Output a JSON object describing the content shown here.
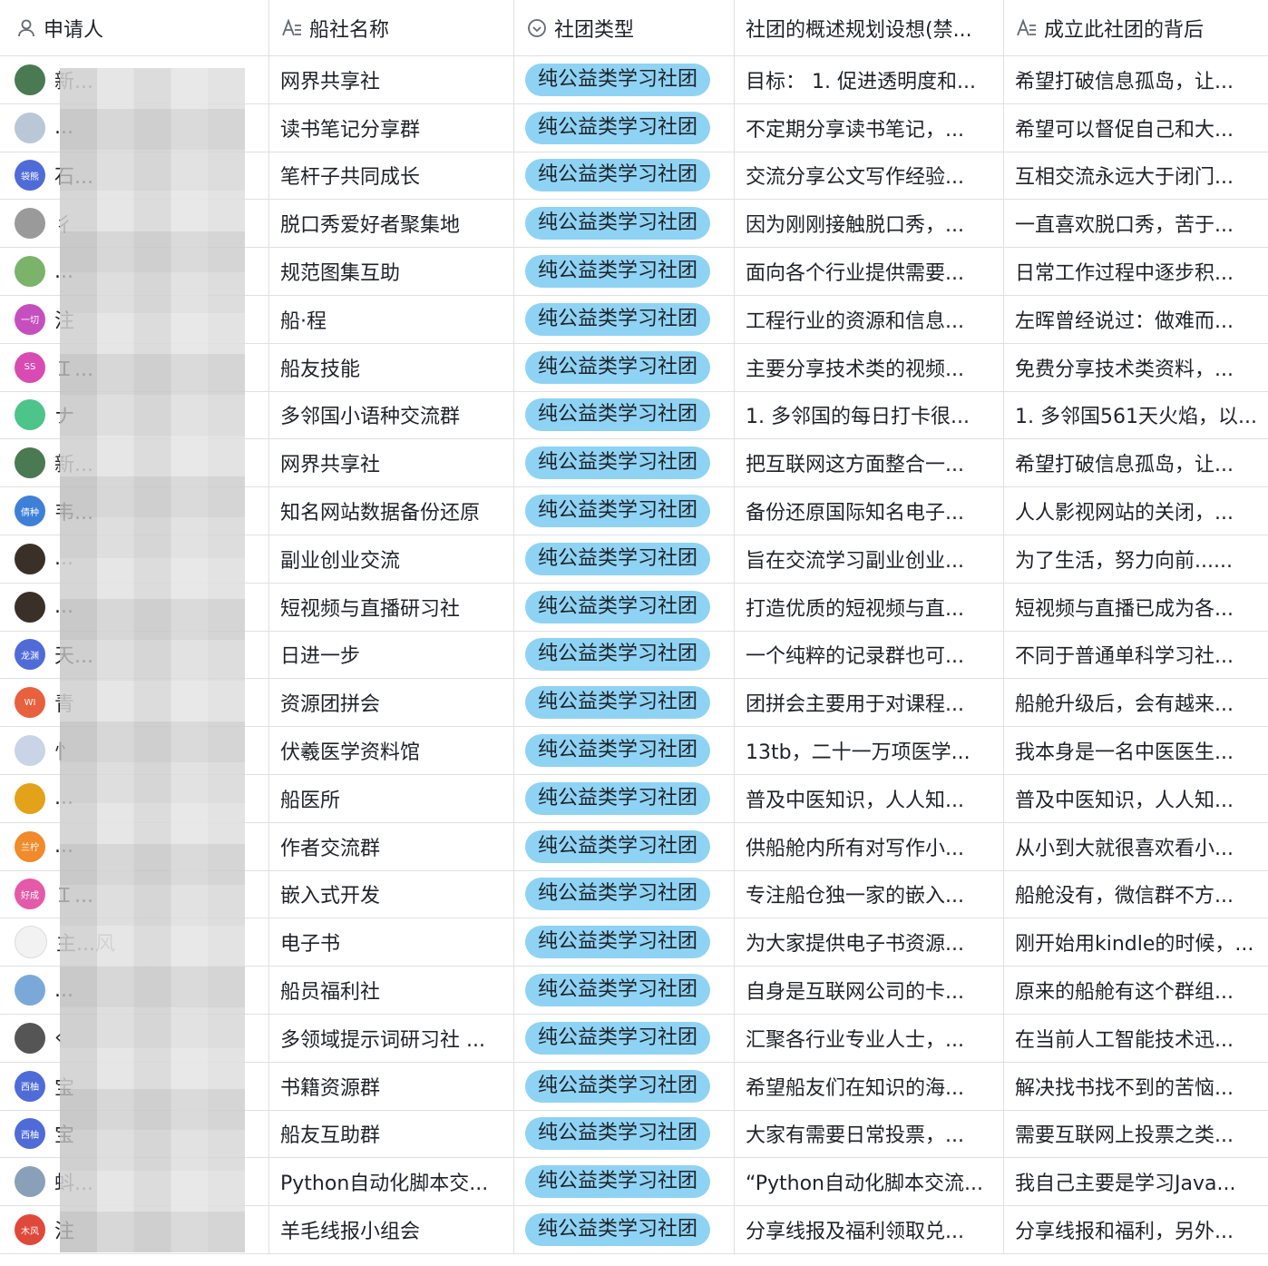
{
  "headers": [
    {
      "label": "申请人",
      "icon": "person-icon"
    },
    {
      "label": "船社名称",
      "icon": "text-field-icon"
    },
    {
      "label": "社团类型",
      "icon": "single-select-icon"
    },
    {
      "label": "社团的概述规划设想(禁...",
      "icon": ""
    },
    {
      "label": "成立此社团的背后",
      "icon": "text-field-icon"
    }
  ],
  "rows": [
    {
      "avatar_text": "",
      "avatar_color": "#4a7a52",
      "applicant": "新...",
      "club": "网界共享社",
      "type": "纯公益类学习社团",
      "overview": "目标： 1. 促进透明度和...",
      "background": "希望打破信息孤岛，让..."
    },
    {
      "avatar_text": "",
      "avatar_color": "#b9c7d6",
      "applicant": "...",
      "club": "读书笔记分享群",
      "type": "纯公益类学习社团",
      "overview": "不定期分享读书笔记，...",
      "background": "希望可以督促自己和大..."
    },
    {
      "avatar_text": "袋熊",
      "avatar_color": "#4f6bd8",
      "applicant": "石...",
      "club": "笔杆子共同成长",
      "type": "纯公益类学习社团",
      "overview": "交流分享公文写作经验...",
      "background": "互相交流永远大于闭门..."
    },
    {
      "avatar_text": "",
      "avatar_color": "#9a9a9a",
      "applicant": "彳",
      "club": "脱口秀爱好者聚集地",
      "type": "纯公益类学习社团",
      "overview": "因为刚刚接触脱口秀，...",
      "background": "一直喜欢脱口秀，苦于..."
    },
    {
      "avatar_text": "",
      "avatar_color": "#7bb36a",
      "applicant": "...",
      "club": "规范图集互助",
      "type": "纯公益类学习社团",
      "overview": "面向各个行业提供需要...",
      "background": "日常工作过程中逐步积..."
    },
    {
      "avatar_text": "一切",
      "avatar_color": "#c64fc0",
      "applicant": "注",
      "club": "船·程",
      "type": "纯公益类学习社团",
      "overview": "工程行业的资源和信息...",
      "background": "左晖曾经说过：做难而..."
    },
    {
      "avatar_text": "SS",
      "avatar_color": "#d94bb3",
      "applicant": "Ｉ...",
      "club": "船友技能",
      "type": "纯公益类学习社团",
      "overview": "主要分享技术类的视频...",
      "background": "免费分享技术类资料，..."
    },
    {
      "avatar_text": "",
      "avatar_color": "#4cc48a",
      "applicant": "ナ",
      "club": "多邻国小语种交流群",
      "type": "纯公益类学习社团",
      "overview": "1. 多邻国的每日打卡很...",
      "background": "1. 多邻国561天火焰，以..."
    },
    {
      "avatar_text": "",
      "avatar_color": "#4a7a52",
      "applicant": "新...",
      "club": "网界共享社",
      "type": "纯公益类学习社团",
      "overview": "把互联网这方面整合一...",
      "background": "希望打破信息孤岛，让..."
    },
    {
      "avatar_text": "倩种",
      "avatar_color": "#3e7fd8",
      "applicant": "韦...",
      "club": "知名网站数据备份还原",
      "type": "纯公益类学习社团",
      "overview": "备份还原国际知名电子...",
      "background": "人人影视网站的关闭，..."
    },
    {
      "avatar_text": "",
      "avatar_color": "#3a3028",
      "applicant": "...",
      "club": "副业创业交流",
      "type": "纯公益类学习社团",
      "overview": "旨在交流学习副业创业...",
      "background": "为了生活，努力向前......"
    },
    {
      "avatar_text": "",
      "avatar_color": "#3a3028",
      "applicant": "...",
      "club": "短视频与直播研习社",
      "type": "纯公益类学习社团",
      "overview": "打造优质的短视频与直...",
      "background": "短视频与直播已成为各..."
    },
    {
      "avatar_text": "龙渊",
      "avatar_color": "#4f6bd8",
      "applicant": "天...",
      "club": "日进一步",
      "type": "纯公益类学习社团",
      "overview": "一个纯粹的记录群也可...",
      "background": "不同于普通单科学习社..."
    },
    {
      "avatar_text": "WI",
      "avatar_color": "#e8603c",
      "applicant": "青",
      "club": "资源团拼会",
      "type": "纯公益类学习社团",
      "overview": "团拼会主要用于对课程...",
      "background": "船舱升级后，会有越来..."
    },
    {
      "avatar_text": "",
      "avatar_color": "#c9d4e6",
      "applicant": "忄",
      "club": "伏羲医学资料馆",
      "type": "纯公益类学习社团",
      "overview": "13tb，二十一万项医学...",
      "background": "我本身是一名中医医生..."
    },
    {
      "avatar_text": "",
      "avatar_color": "#e3a21a",
      "applicant": "...",
      "club": "船医所",
      "type": "纯公益类学习社团",
      "overview": "普及中医知识，人人知...",
      "background": "普及中医知识，人人知..."
    },
    {
      "avatar_text": "兰柠",
      "avatar_color": "#f08a2a",
      "applicant": "...",
      "club": "作者交流群",
      "type": "纯公益类学习社团",
      "overview": "供船舱内所有对写作小...",
      "background": "从小到大就很喜欢看小..."
    },
    {
      "avatar_text": "好成",
      "avatar_color": "#e45aa8",
      "applicant": "Ｉ...",
      "club": "嵌入式开发",
      "type": "纯公益类学习社团",
      "overview": "专注船仓独一家的嵌入...",
      "background": "船舱没有，微信群不方..."
    },
    {
      "avatar_text": "",
      "avatar_color": "#f2f2f2",
      "applicant": "主...风",
      "club": "电子书",
      "type": "纯公益类学习社团",
      "overview": "为大家提供电子书资源...",
      "background": "刚开始用kindle的时候，..."
    },
    {
      "avatar_text": "",
      "avatar_color": "#7aa9d9",
      "applicant": "...",
      "club": "船员福利社",
      "type": "纯公益类学习社团",
      "overview": "自身是互联网公司的卡...",
      "background": "原来的船舱有这个群组..."
    },
    {
      "avatar_text": "",
      "avatar_color": "#555555",
      "applicant": "‹",
      "club": "多领域提示词研习社 ...",
      "type": "纯公益类学习社团",
      "overview": "汇聚各行业专业人士，...",
      "background": "在当前人工智能技术迅..."
    },
    {
      "avatar_text": "西柚",
      "avatar_color": "#4f6bd8",
      "applicant": "宝",
      "club": "书籍资源群",
      "type": "纯公益类学习社团",
      "overview": "希望船友们在知识的海...",
      "background": "解决找书找不到的苦恼..."
    },
    {
      "avatar_text": "西柚",
      "avatar_color": "#4f6bd8",
      "applicant": "宝",
      "club": "船友互助群",
      "type": "纯公益类学习社团",
      "overview": "大家有需要日常投票，...",
      "background": "需要互联网上投票之类..."
    },
    {
      "avatar_text": "",
      "avatar_color": "#8aa0b8",
      "applicant": "蚪...",
      "club": "Python自动化脚本交...",
      "type": "纯公益类学习社团",
      "overview": "“Python自动化脚本交流...",
      "background": "我自己主要是学习Java..."
    },
    {
      "avatar_text": "木风",
      "avatar_color": "#e0483a",
      "applicant": "注",
      "club": "羊毛线报小组会",
      "type": "纯公益类学习社团",
      "overview": "分享线报及福利领取兑...",
      "background": "分享线报和福利，另外..."
    }
  ]
}
